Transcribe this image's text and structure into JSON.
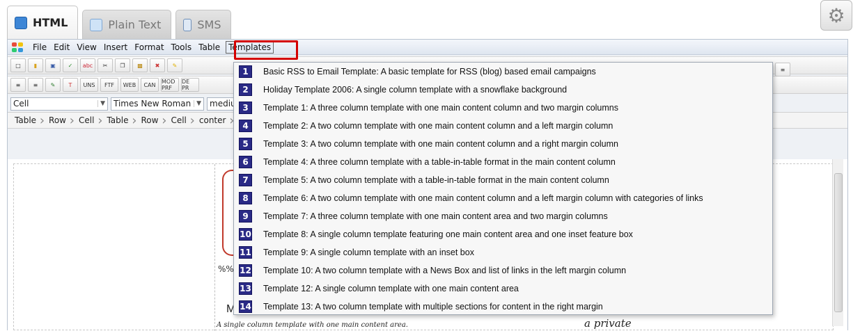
{
  "tabs": [
    {
      "label": "HTML",
      "icon": "html-icon"
    },
    {
      "label": "Plain Text",
      "icon": "document-icon"
    },
    {
      "label": "SMS",
      "icon": "phone-icon"
    }
  ],
  "menubar": {
    "items": [
      "File",
      "Edit",
      "View",
      "Insert",
      "Format",
      "Tools",
      "Table",
      "Templates"
    ],
    "active": "Templates"
  },
  "toolbar_labels": {
    "uns": "UNS",
    "ftf": "FTF",
    "web": "WEB",
    "can": "CAN",
    "mod_prf": "MOD PRF",
    "de_pr": "DE PR"
  },
  "format": {
    "block": "Cell",
    "font": "Times New Roman",
    "size": "medium"
  },
  "breadcrumb": [
    "Table",
    "Row",
    "Cell",
    "Table",
    "Row",
    "Cell",
    "conter"
  ],
  "doc_fragments": {
    "percent": "%%",
    "m": "M",
    "desc": "A single column template with one main content area.",
    "private": "a private"
  },
  "templates": [
    {
      "num": "1",
      "label": "Basic RSS to Email Template: A basic template for RSS (blog) based email campaigns"
    },
    {
      "num": "2",
      "label": "Holiday Template 2006: A single column template with a snowflake background"
    },
    {
      "num": "3",
      "label": "Template 1: A three column template with one main content column and two margin columns"
    },
    {
      "num": "4",
      "label": "Template 2: A two column template with one main content column and a left margin column"
    },
    {
      "num": "5",
      "label": "Template 3: A two column template with one main content column and a right margin column"
    },
    {
      "num": "6",
      "label": "Template 4: A three column template with a table-in-table format in the main content column"
    },
    {
      "num": "7",
      "label": "Template 5: A two column template with a table-in-table format in the main content column"
    },
    {
      "num": "8",
      "label": "Template 6: A two column template with one main content column and a left margin column with categories of links"
    },
    {
      "num": "9",
      "label": "Template 7: A three column template with one main content area and two margin columns"
    },
    {
      "num": "10",
      "label": "Template 8: A single column template featuring one main content area and one inset feature box"
    },
    {
      "num": "11",
      "label": "Template 9: A single column template with an inset box"
    },
    {
      "num": "12",
      "label": "Template 10: A two column template with a News Box and list of links in the left margin column"
    },
    {
      "num": "13",
      "label": "Template 12: A single column template with one main content area"
    },
    {
      "num": "14",
      "label": "Template 13: A two column template with multiple sections for content in the right margin"
    }
  ],
  "colors": {
    "number_badge": "#2a2a86",
    "highlight_outline": "#d40000"
  }
}
